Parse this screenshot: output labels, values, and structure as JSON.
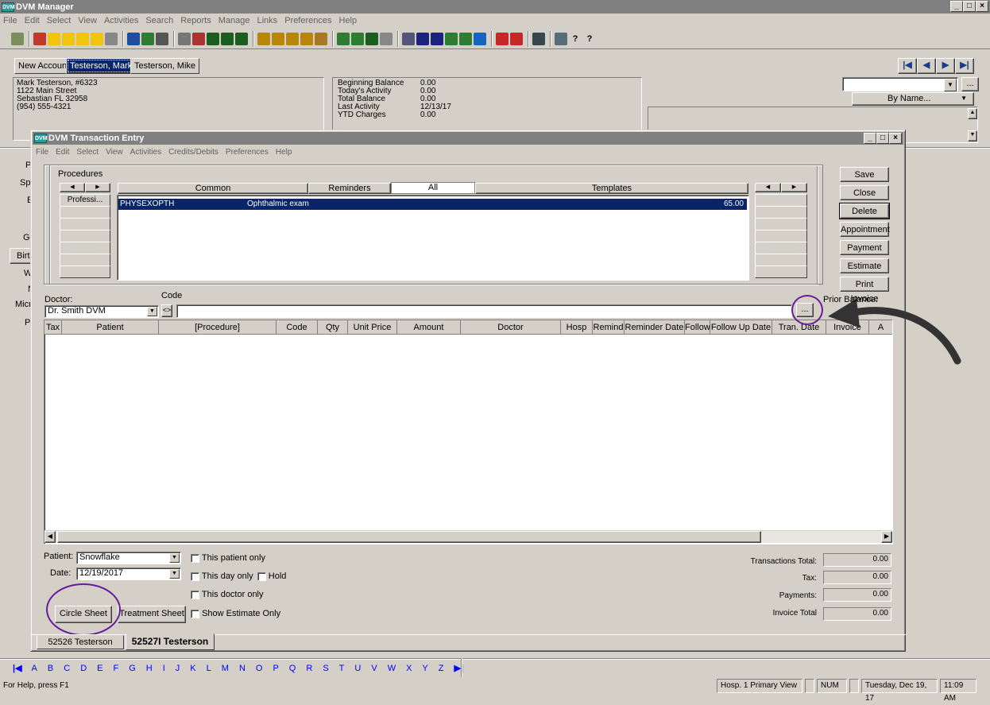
{
  "main_window": {
    "title": "DVM Manager",
    "menu": [
      "File",
      "Edit",
      "Select",
      "View",
      "Activities",
      "Search",
      "Reports",
      "Manage",
      "Links",
      "Preferences",
      "Help"
    ]
  },
  "account_tabs": [
    "New Account",
    "Testerson, Mark",
    "Testerson, Mike"
  ],
  "client": {
    "name_line": "Mark Testerson, #6323",
    "street": "1122 Main Street",
    "city": "Sebastian FL  32958",
    "phone": "(954) 555-4321"
  },
  "balances": {
    "labels": [
      "Beginning Balance",
      "Today's Activity",
      "Total Balance",
      "Last Activity",
      "YTD Charges"
    ],
    "values": [
      "0.00",
      "0.00",
      "0.00",
      "12/13/17",
      "0.00"
    ]
  },
  "search": {
    "by": "By Name..."
  },
  "left_panel_fragments": [
    "P",
    "Sp",
    "E",
    "Ge",
    "Birth",
    "W",
    "N",
    "Micr",
    "P"
  ],
  "trans_window": {
    "title": "DVM Transaction Entry",
    "menu": [
      "File",
      "Edit",
      "Select",
      "View",
      "Activities",
      "Credits/Debits",
      "Preferences",
      "Help"
    ],
    "procedures_label": "Procedures",
    "proc_tabs": [
      "Common",
      "Reminders",
      "All",
      "Templates"
    ],
    "left_buttons": [
      "Professi..."
    ],
    "proc_rows": [
      {
        "code": "PHYSEXOPTH",
        "desc": "Ophthalmic exam",
        "price": "65.00"
      }
    ],
    "side_buttons": [
      "Save",
      "Close",
      "Delete",
      "Appointment",
      "Payment",
      "Estimate",
      "Print Invoice"
    ],
    "doctor_label": "Doctor:",
    "doctor_value": "Dr. Smith DVM",
    "code_label": "Code",
    "code_toggle": "<>",
    "prior_balance_label": "Prior Balance:",
    "ellipsis": "...",
    "columns": [
      "Tax",
      "Patient",
      "[Procedure]",
      "Code",
      "Qty",
      "Unit Price",
      "Amount",
      "Doctor",
      "Hosp",
      "Remind",
      "Reminder Date",
      "Follow",
      "Follow Up Date",
      "Tran. Date",
      "Invoice",
      "A"
    ],
    "patient_label": "Patient:",
    "patient_value": "Snowflake",
    "date_label": "Date:",
    "date_value": "12/19/2017",
    "checkboxes": {
      "patient_only": "This patient only",
      "day_only": "This day only",
      "hold": "Hold",
      "doctor_only": "This doctor only",
      "estimate_only": "Show Estimate Only"
    },
    "circle_sheet": "Circle Sheet",
    "treatment_sheet": "Treatment Sheet",
    "totals": [
      {
        "label": "Transactions Total:",
        "value": "0.00"
      },
      {
        "label": "Tax:",
        "value": "0.00"
      },
      {
        "label": "Payments:",
        "value": "0.00"
      },
      {
        "label": "Invoice Total",
        "value": "0.00"
      }
    ],
    "bottom_tabs": [
      "52526 Testerson",
      "52527I Testerson"
    ]
  },
  "alphabet": [
    "A",
    "B",
    "C",
    "D",
    "E",
    "F",
    "G",
    "H",
    "I",
    "J",
    "K",
    "L",
    "M",
    "N",
    "O",
    "P",
    "Q",
    "R",
    "S",
    "T",
    "U",
    "V",
    "W",
    "X",
    "Y",
    "Z"
  ],
  "status": {
    "help": "For Help, press F1",
    "view": "Hosp. 1 Primary View",
    "num": "NUM",
    "datetime": "Tuesday, Dec 19, 17",
    "time": "11:09 AM"
  },
  "colors": {
    "selection": "#0a246a",
    "highlight_circle": "#6a1b9a",
    "arrow": "#333333"
  }
}
